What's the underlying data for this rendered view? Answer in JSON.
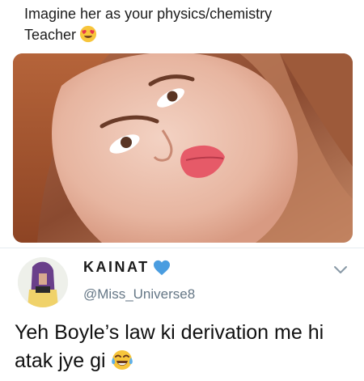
{
  "quoted_tweet": {
    "text_line1": "Imagine her as your physics/chemistry",
    "text_line2": "Teacher",
    "emoji": "heart-eyes-emoji",
    "image": "portrait-photo"
  },
  "tweet": {
    "display_name": "KAINAT",
    "verified_badge": "blue-heart-emoji",
    "handle": "@Miss_Universe8",
    "text_line1": "Yeh Boyle’s law ki derivation me hi",
    "text_line2": "atak jye gi",
    "emoji": "tears-of-joy-emoji",
    "menu_icon": "chevron-down-icon"
  },
  "colors": {
    "handle": "#657786",
    "blue_heart": "#4a9de0",
    "divider": "#e6ecf0"
  }
}
